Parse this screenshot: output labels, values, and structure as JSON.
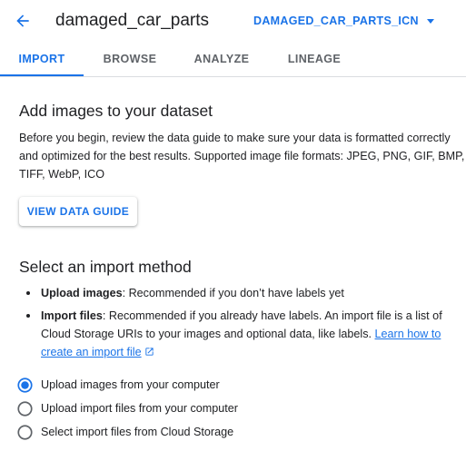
{
  "header": {
    "title": "damaged_car_parts",
    "dataset_select_value": "DAMAGED_CAR_PARTS_ICN"
  },
  "tabs": [
    {
      "label": "IMPORT",
      "active": true
    },
    {
      "label": "BROWSE",
      "active": false
    },
    {
      "label": "ANALYZE",
      "active": false
    },
    {
      "label": "LINEAGE",
      "active": false
    }
  ],
  "add_images": {
    "heading": "Add images to your dataset",
    "description": "Before you begin, review the data guide to make sure your data is formatted correctly and optimized for the best results. Supported image file formats: JPEG, PNG, GIF, BMP, TIFF, WebP, ICO",
    "guide_button": "VIEW DATA GUIDE"
  },
  "import_method": {
    "heading": "Select an import method",
    "bullets": [
      {
        "term": "Upload images",
        "text": ": Recommended if you don’t have labels yet"
      },
      {
        "term": "Import files",
        "text": ": Recommended if you already have labels. An import file is a list of Cloud Storage URIs to your images and optional data, like labels. ",
        "link": "Learn how to create an import file"
      }
    ],
    "options": [
      {
        "label": "Upload images from your computer",
        "selected": true
      },
      {
        "label": "Upload import files from your computer",
        "selected": false
      },
      {
        "label": "Select import files from Cloud Storage",
        "selected": false
      }
    ]
  },
  "colors": {
    "accent": "#1a73e8",
    "text": "#202124",
    "muted": "#5f6368",
    "divider": "#dadce0"
  },
  "icons": [
    "arrow-back-icon",
    "dropdown-caret-icon",
    "open-in-new-icon",
    "radio-checked-icon",
    "radio-unchecked-icon"
  ]
}
